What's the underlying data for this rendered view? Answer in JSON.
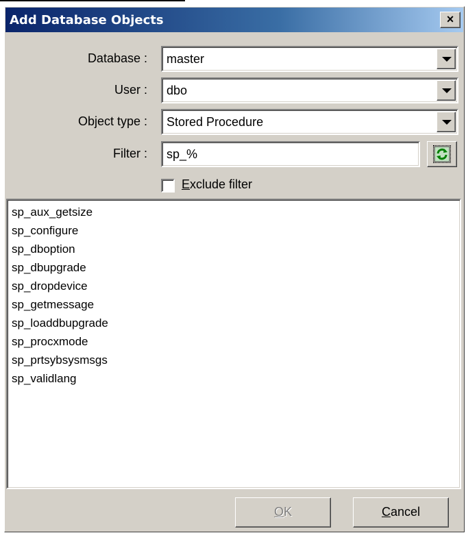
{
  "window": {
    "title": "Add Database Objects",
    "close_glyph": "×"
  },
  "form": {
    "database": {
      "label": "Database :",
      "value": "master"
    },
    "user": {
      "label": "User :",
      "value": "dbo"
    },
    "object_type": {
      "label": "Object type :",
      "value": "Stored Procedure"
    },
    "filter": {
      "label": "Filter :",
      "value": "sp_%"
    },
    "exclude_filter": {
      "mnemonic": "E",
      "rest": "xclude filter",
      "checked": false
    }
  },
  "objects": [
    "sp_aux_getsize",
    "sp_configure",
    "sp_dboption",
    "sp_dbupgrade",
    "sp_dropdevice",
    "sp_getmessage",
    "sp_loaddbupgrade",
    "sp_procxmode",
    "sp_prtsybsysmsgs",
    "sp_validlang"
  ],
  "buttons": {
    "ok": {
      "mnemonic": "O",
      "rest": "K",
      "enabled": false
    },
    "cancel": {
      "mnemonic": "C",
      "rest": "ancel",
      "enabled": true
    }
  },
  "icons": {
    "close": "close-icon",
    "dropdown": "chevron-down-icon",
    "refresh": "refresh-icon"
  }
}
